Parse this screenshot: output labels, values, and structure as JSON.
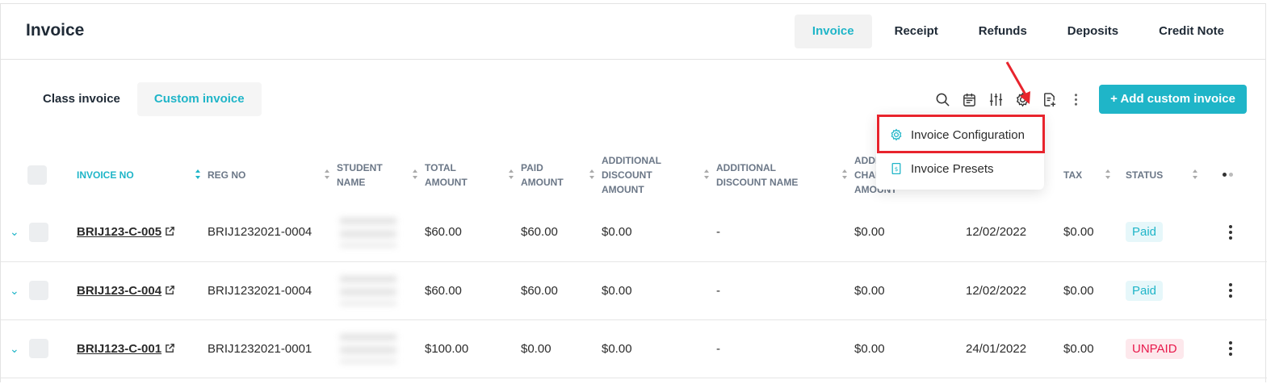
{
  "page_title": "Invoice",
  "top_tabs": [
    {
      "label": "Invoice",
      "active": true
    },
    {
      "label": "Receipt",
      "active": false
    },
    {
      "label": "Refunds",
      "active": false
    },
    {
      "label": "Deposits",
      "active": false
    },
    {
      "label": "Credit Note",
      "active": false
    }
  ],
  "sub_tabs": [
    {
      "label": "Class invoice",
      "active": false
    },
    {
      "label": "Custom invoice",
      "active": true
    }
  ],
  "toolbar": {
    "icons": [
      "search-icon",
      "calendar-icon",
      "filter-sliders-icon",
      "gear-icon",
      "document-export-icon",
      "more-vertical-icon"
    ],
    "add_button": "+ Add custom invoice"
  },
  "dropdown": {
    "items": [
      {
        "label": "Invoice Configuration",
        "icon": "gear-icon"
      },
      {
        "label": "Invoice Presets",
        "icon": "invoice-preset-icon"
      }
    ]
  },
  "table": {
    "columns": [
      "INVOICE NO",
      "REG NO",
      "STUDENT NAME",
      "TOTAL AMOUNT",
      "PAID AMOUNT",
      "ADDITIONAL DISCOUNT AMOUNT",
      "ADDITIONAL DISCOUNT NAME",
      "ADDITIONAL CHARGE AMOUNT",
      "",
      "TAX",
      "STATUS"
    ],
    "columns_visible": {
      "invoice_no": "INVOICE NO",
      "reg_no": "REG NO",
      "student_name": "STUDENT NAME",
      "total_amount": "TOTAL AMOUNT",
      "paid_amount": "PAID AMOUNT",
      "add_discount_amount": "ADDITIONAL DISCOUNT AMOUNT",
      "add_discount_name": "ADDITIONAL DISCOUNT NAME",
      "add_charge_amount": "ADDITIONAL CHARGE AMOUNT",
      "tax": "TAX",
      "status": "STATUS"
    },
    "rows": [
      {
        "invoice_no": "BRIJ123-C-005",
        "reg_no": "BRIJ1232021-0004",
        "total": "$60.00",
        "paid": "$60.00",
        "discount_amount": "$0.00",
        "discount_name": "-",
        "charge_amount": "$0.00",
        "date": "12/02/2022",
        "tax": "$0.00",
        "status": "Paid"
      },
      {
        "invoice_no": "BRIJ123-C-004",
        "reg_no": "BRIJ1232021-0004",
        "total": "$60.00",
        "paid": "$60.00",
        "discount_amount": "$0.00",
        "discount_name": "-",
        "charge_amount": "$0.00",
        "date": "12/02/2022",
        "tax": "$0.00",
        "status": "Paid"
      },
      {
        "invoice_no": "BRIJ123-C-001",
        "reg_no": "BRIJ1232021-0001",
        "total": "$100.00",
        "paid": "$0.00",
        "discount_amount": "$0.00",
        "discount_name": "-",
        "charge_amount": "$0.00",
        "date": "24/01/2022",
        "tax": "$0.00",
        "status": "UNPAID"
      }
    ]
  },
  "colors": {
    "accent": "#1fb5c8",
    "unpaid": "#e8184b",
    "highlight": "#e8242d"
  }
}
